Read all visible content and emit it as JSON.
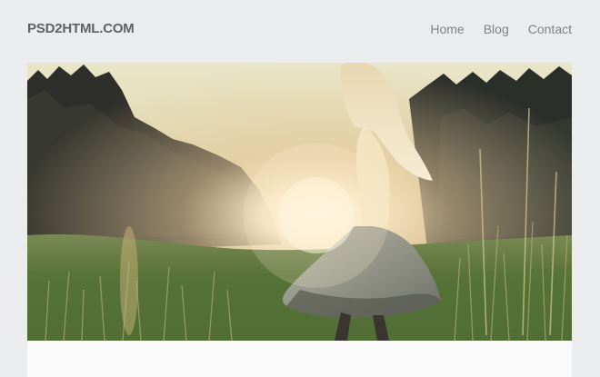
{
  "header": {
    "logo": "PSD2HTML.COM",
    "nav": [
      {
        "label": "Home"
      },
      {
        "label": "Blog"
      },
      {
        "label": "Contact"
      }
    ]
  },
  "hero": {
    "image": "girl twirling in sunlit grassy meadow with trees"
  },
  "colors": {
    "page_bg": "#ebecee",
    "logo": "#5f6165",
    "nav": "#7f8185",
    "card_bg": "#fafafa"
  }
}
